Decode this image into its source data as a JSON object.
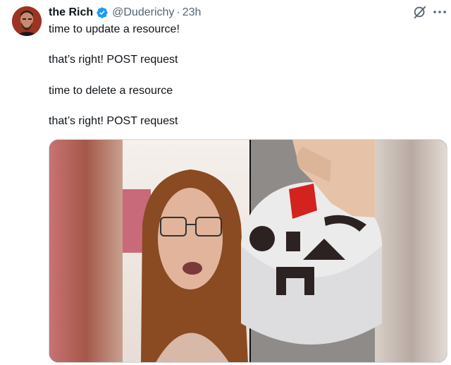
{
  "tweet": {
    "display_name": "the Rich",
    "handle": "@Duderichy",
    "separator": "·",
    "time": "23h",
    "lines": [
      "time to update a resource!",
      "that’s right! POST request",
      "time to delete a resource",
      "that’s right! POST request"
    ]
  },
  "icons": {
    "verified": "verified-badge-icon",
    "grok": "grok-icon",
    "more": "more-options-icon"
  },
  "colors": {
    "verified": "#1d9bf0",
    "secondary_text": "#536471",
    "primary_text": "#0f1419"
  }
}
